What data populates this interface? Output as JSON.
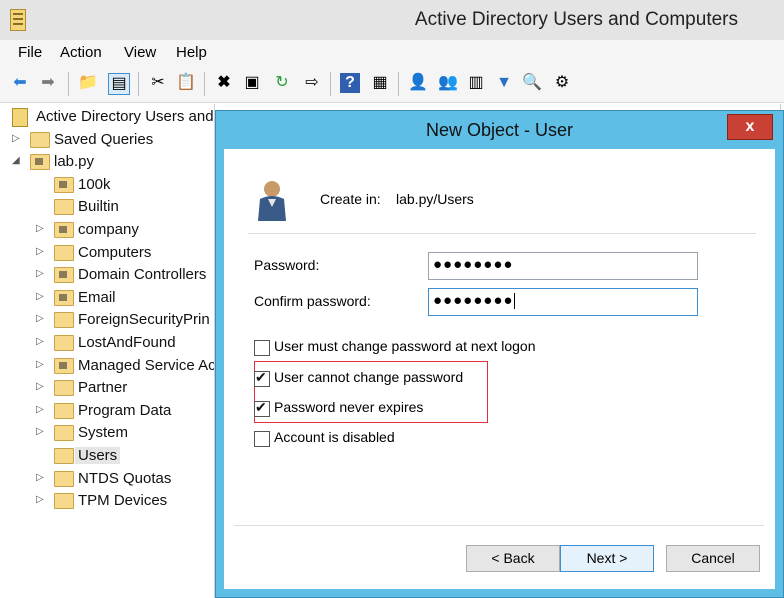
{
  "window": {
    "title": "Active Directory Users and Computers"
  },
  "menu": [
    "File",
    "Action",
    "View",
    "Help"
  ],
  "tree": {
    "root": "Active Directory Users and",
    "items": [
      {
        "label": "Saved Queries",
        "indent": 1,
        "arrow": "▷"
      },
      {
        "label": "lab.py",
        "indent": 1,
        "arrow": "◢"
      },
      {
        "label": "100k",
        "indent": 2,
        "arrow": ""
      },
      {
        "label": "Builtin",
        "indent": 2,
        "arrow": ""
      },
      {
        "label": "company",
        "indent": 2,
        "arrow": "▷"
      },
      {
        "label": "Computers",
        "indent": 2,
        "arrow": "▷"
      },
      {
        "label": "Domain Controllers",
        "indent": 2,
        "arrow": "▷"
      },
      {
        "label": "Email",
        "indent": 2,
        "arrow": "▷"
      },
      {
        "label": "ForeignSecurityPrin",
        "indent": 2,
        "arrow": "▷"
      },
      {
        "label": "LostAndFound",
        "indent": 2,
        "arrow": "▷"
      },
      {
        "label": "Managed Service Ac",
        "indent": 2,
        "arrow": "▷"
      },
      {
        "label": "Partner",
        "indent": 2,
        "arrow": "▷"
      },
      {
        "label": "Program Data",
        "indent": 2,
        "arrow": "▷"
      },
      {
        "label": "System",
        "indent": 2,
        "arrow": "▷"
      },
      {
        "label": "Users",
        "indent": 2,
        "arrow": "",
        "selected": true
      },
      {
        "label": "NTDS Quotas",
        "indent": 2,
        "arrow": "▷"
      },
      {
        "label": "TPM Devices",
        "indent": 2,
        "arrow": "▷"
      }
    ]
  },
  "dialog": {
    "title": "New Object - User",
    "close": "x",
    "create_in_label": "Create in:",
    "create_in_value": "lab.py/Users",
    "password_label": "Password:",
    "password_value": "●●●●●●●●",
    "confirm_label": "Confirm password:",
    "confirm_value": "●●●●●●●●",
    "options": [
      {
        "label": "User must change password at next logon",
        "checked": false
      },
      {
        "label": "User cannot change password",
        "checked": true
      },
      {
        "label": "Password never expires",
        "checked": true
      },
      {
        "label": "Account is disabled",
        "checked": false
      }
    ],
    "back": "< Back",
    "next": "Next >",
    "cancel": "Cancel"
  },
  "colors": {
    "dialog_frame": "#5ebee6",
    "close_button": "#c94135",
    "highlight": "#e0303a"
  }
}
